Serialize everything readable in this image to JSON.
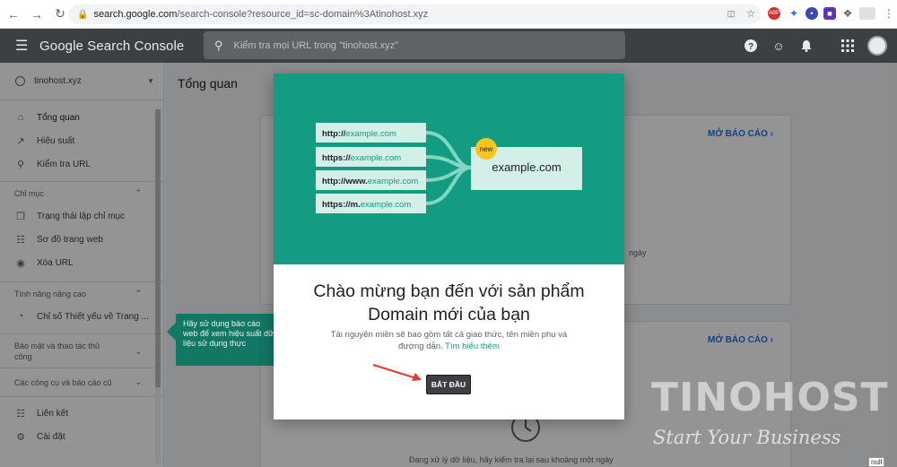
{
  "browser": {
    "url_host": "search.google.com",
    "url_path": "/search-console?resource_id=sc-domain%3Atinohost.xyz"
  },
  "app": {
    "title": "Google Search Console",
    "search_placeholder": "Kiểm tra mọi URL trong \"tinohost.xyz\""
  },
  "sidebar": {
    "property": "tinohost.xyz",
    "items": [
      {
        "label": "Tổng quan",
        "icon": "home-icon"
      },
      {
        "label": "Hiệu suất",
        "icon": "trending-up-icon"
      },
      {
        "label": "Kiểm tra URL",
        "icon": "search-icon"
      }
    ],
    "section_index": "Chỉ mục",
    "index_items": [
      {
        "label": "Trạng thái lập chỉ mục",
        "icon": "pages-icon"
      },
      {
        "label": "Sơ đồ trang web",
        "icon": "sitemap-icon"
      },
      {
        "label": "Xóa URL",
        "icon": "visibility-off-icon"
      }
    ],
    "section_enhancements": "Tính năng nâng cao",
    "enhancement_items": [
      {
        "label": "Chỉ số Thiết yếu về Trang ...",
        "icon": "speed-icon"
      }
    ],
    "section_security": "Bảo mật và thao tác thủ công",
    "section_tools": "Các công cụ và báo cáo cũ",
    "bottom_items": [
      {
        "label": "Liên kết",
        "icon": "links-icon"
      },
      {
        "label": "Cài đặt",
        "icon": "settings-icon"
      }
    ]
  },
  "main": {
    "title": "Tổng quan",
    "open_report_1": "MỞ BÁO CÁO",
    "open_report_2": "MỞ BÁO CÁO",
    "partial_text_1": "ngày",
    "processing_text": "Đang xử lý dữ liệu, hãy kiểm tra lại sau khoảng một ngày"
  },
  "tooltip": {
    "text": "Hãy sử dụng báo cáo web để xem hiệu suất dữ liệu sử dụng thực"
  },
  "dialog": {
    "urls": [
      "http://example.com",
      "https://example.com",
      "http://www.example.com",
      "https://m.example.com"
    ],
    "url_prefixes": [
      "http://",
      "https://",
      "http://www.",
      "https://m."
    ],
    "url_suffixes": [
      "example.com",
      "example.com",
      "example.com",
      "example.com"
    ],
    "domain": "example.com",
    "badge": "new",
    "title_line1": "Chào mừng bạn đến với sản phẩm",
    "title_line2": "Domain mới của bạn",
    "desc": "Tài nguyên miền sẽ bao gồm tất cả giao thức, tên miền phụ và đường dẫn.",
    "learn_more": "Tìm hiểu thêm",
    "start_button": "BẮT ĐẦU"
  },
  "watermark": {
    "brand": "TINOHOST",
    "tagline": "Start Your Business"
  },
  "null_label": "null",
  "colors": {
    "appbar": "#3c4043",
    "hero": "#149c82",
    "link": "#1a73e8",
    "tooltip": "#137765"
  }
}
